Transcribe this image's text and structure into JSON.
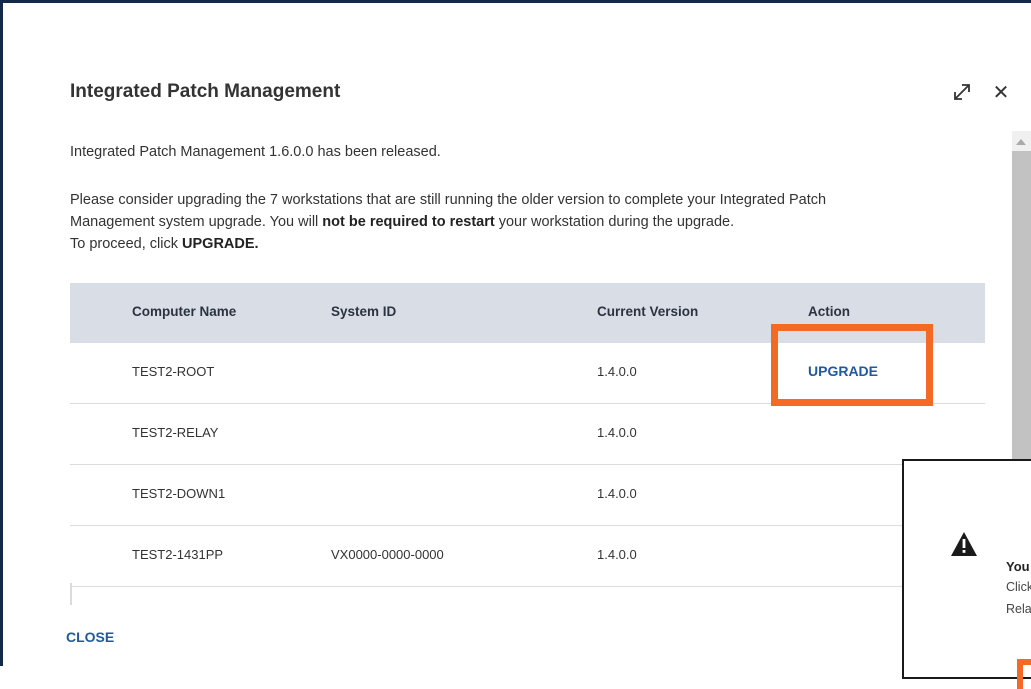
{
  "dialog": {
    "title": "Integrated Patch Management",
    "release_text": "Integrated Patch Management 1.6.0.0 has been released.",
    "body_line1": "Please consider upgrading the 7 workstations that are still running the older version to complete your Integrated Patch",
    "body_line2_a": "Management system upgrade. You will ",
    "body_line2_bold": "not be required to restart",
    "body_line2_b": " your workstation during the upgrade.",
    "body_line3_a": "To proceed, click ",
    "body_line3_bold": "UPGRADE."
  },
  "table": {
    "headers": [
      "Computer Name",
      "System ID",
      "Current Version",
      "Action"
    ],
    "rows": [
      {
        "name": "TEST2-ROOT",
        "system_id": "",
        "version": "1.4.0.0",
        "action": "UPGRADE"
      },
      {
        "name": "TEST2-RELAY",
        "system_id": "",
        "version": "1.4.0.0",
        "action": ""
      },
      {
        "name": "TEST2-DOWN1",
        "system_id": "",
        "version": "1.4.0.0",
        "action": ""
      },
      {
        "name": "TEST2-1431PP",
        "system_id": "VX0000-0000-0000",
        "version": "1.4.0.0",
        "action": ""
      }
    ]
  },
  "footer": {
    "close_label": "CLOSE"
  },
  "popup": {
    "title": "You",
    "line1": "Click",
    "line2": "Rela"
  },
  "icons": {
    "expand": "expand-icon",
    "close": "close-icon",
    "warning": "warning-icon"
  },
  "colors": {
    "accent_link": "#1f5aa0",
    "highlight": "#f26a24",
    "header_bg": "#d9dee6",
    "frame_border": "#13294b"
  }
}
